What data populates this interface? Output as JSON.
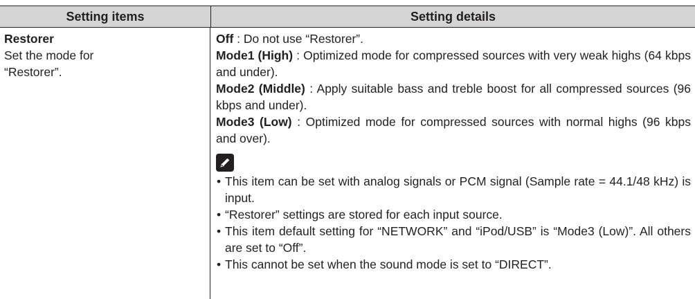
{
  "header": {
    "col1": "Setting items",
    "col2": "Setting details"
  },
  "item": {
    "name": "Restorer",
    "description": "Set the mode for\n“Restorer”."
  },
  "options": [
    {
      "name": "Off",
      "text": " : Do not use “Restorer”."
    },
    {
      "name": "Mode1 (High)",
      "text": " : Optimized mode for compressed sources with very weak highs (64 kbps and under)."
    },
    {
      "name": "Mode2 (Middle)",
      "text": " : Apply suitable bass and treble boost for all compressed sources (96 kbps and under)."
    },
    {
      "name": "Mode3 (Low)",
      "text": " : Optimized mode for compressed sources with normal highs (96 kbps and over)."
    }
  ],
  "note_icon": "pencil-icon",
  "notes": [
    "This item can be set with analog signals or PCM signal (Sample rate = 44.1/48 kHz) is input.",
    "“Restorer” settings are stored for each input source.",
    "This item default setting for “NETWORK” and “iPod/USB” is “Mode3 (Low)”. All others are set to “Off”.",
    "This cannot be set when the sound mode is set to “DIRECT”."
  ]
}
